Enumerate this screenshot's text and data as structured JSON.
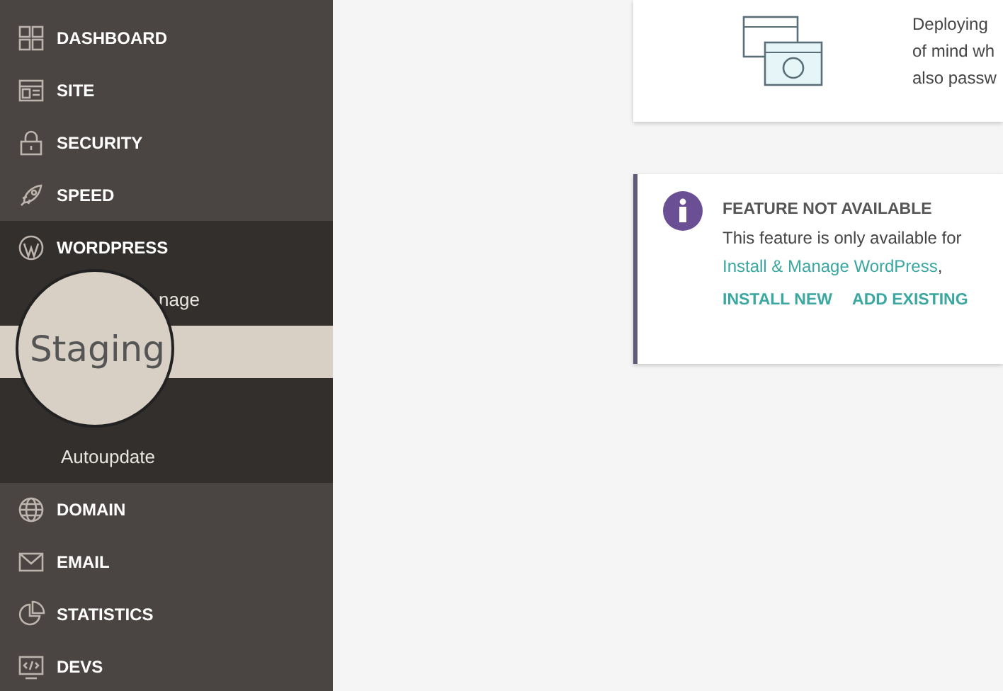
{
  "sidebar": {
    "items": [
      {
        "label": "DASHBOARD",
        "kind": "dashboard",
        "selected": false
      },
      {
        "label": "SITE",
        "kind": "site",
        "selected": false
      },
      {
        "label": "SECURITY",
        "kind": "lock",
        "selected": false
      },
      {
        "label": "SPEED",
        "kind": "rocket",
        "selected": false
      },
      {
        "label": "WORDPRESS",
        "kind": "wordpress",
        "selected": false,
        "expanded": true,
        "children": [
          {
            "label": "nage",
            "selected": false
          },
          {
            "label": "Staging",
            "selected": true
          },
          {
            "label": "Autoupdate",
            "selected": false
          }
        ]
      },
      {
        "label": "DOMAIN",
        "kind": "globe",
        "selected": false
      },
      {
        "label": "EMAIL",
        "kind": "mail",
        "selected": false
      },
      {
        "label": "STATISTICS",
        "kind": "chart",
        "selected": false
      },
      {
        "label": "DEVS",
        "kind": "code",
        "selected": false
      }
    ]
  },
  "intro_card": {
    "lines": [
      "Deploying",
      "of mind wh",
      "also passw"
    ]
  },
  "notice": {
    "title": "FEATURE NOT AVAILABLE",
    "text": "This feature is only available for",
    "link": "Install & Manage WordPress",
    "after_link": ",",
    "actions": [
      "INSTALL NEW",
      "ADD EXISTING"
    ]
  }
}
